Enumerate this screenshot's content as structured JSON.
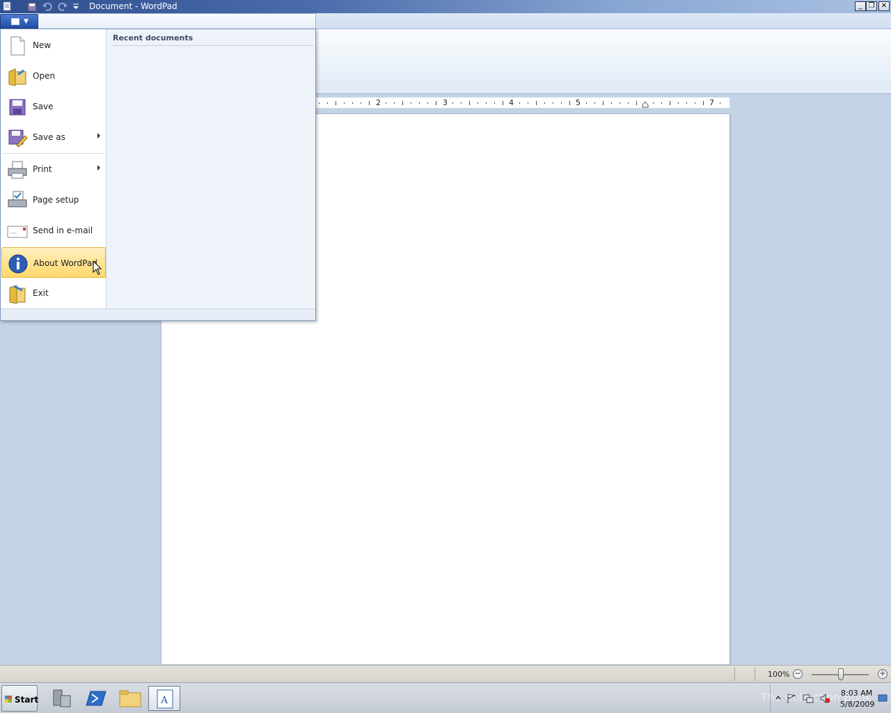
{
  "window": {
    "title": "Document - WordPad",
    "minimize": "_",
    "maximize": "❐",
    "close": "✕",
    "help": "?"
  },
  "ruler": {
    "numbers": [
      "2",
      "3",
      "4",
      "5",
      "7"
    ]
  },
  "app_menu": {
    "items": [
      {
        "label": "New",
        "icon": "new-document-icon"
      },
      {
        "label": "Open",
        "icon": "open-folder-icon"
      },
      {
        "label": "Save",
        "icon": "save-disk-icon"
      },
      {
        "label": "Save as",
        "icon": "save-as-icon",
        "submenu": true
      },
      {
        "label": "Print",
        "icon": "printer-icon",
        "submenu": true
      },
      {
        "label": "Page setup",
        "icon": "page-setup-icon"
      },
      {
        "label": "Send in e-mail",
        "icon": "email-icon"
      },
      {
        "label": "About WordPad",
        "icon": "info-icon"
      },
      {
        "label": "Exit",
        "icon": "exit-icon"
      }
    ],
    "recent_title": "Recent documents"
  },
  "status": {
    "zoom": "100%",
    "zoom_out": "−",
    "zoom_in": "+"
  },
  "taskbar": {
    "start": "Start",
    "time": "8:03 AM",
    "date": "5/8/2009",
    "watermark": "The Collection Book"
  }
}
